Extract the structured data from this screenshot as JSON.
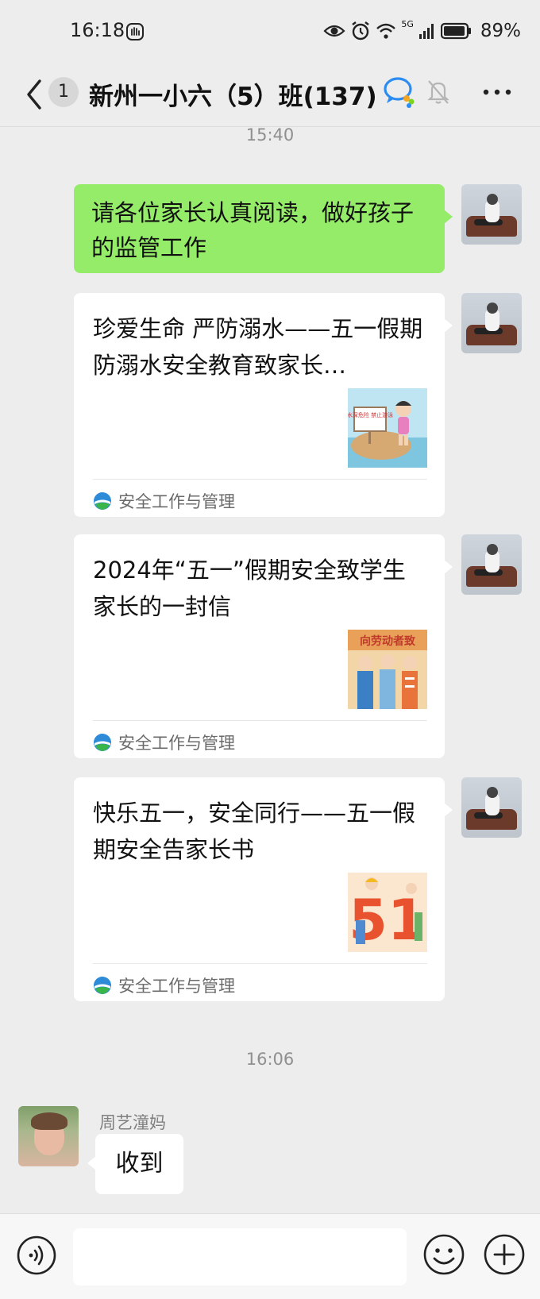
{
  "status_bar": {
    "time": "16:18",
    "network": "5G",
    "battery": "89%"
  },
  "header": {
    "unread_count": "1",
    "title": "新州一小六（5）班(137)"
  },
  "timestamps": [
    "15:40",
    "16:06"
  ],
  "messages": {
    "text_out": "请各位家长认真阅读，做好孩子的监管工作",
    "cards": [
      {
        "title": "珍爱生命 严防溺水——五一假期防溺水安全教育致家长…",
        "source": "安全工作与管理",
        "thumb_text": "水深危险 禁止游泳"
      },
      {
        "title": "2024年“五一”假期安全致学生家长的一封信",
        "source": "安全工作与管理",
        "thumb_text": "向劳动者致"
      },
      {
        "title": "快乐五一，安全同行——五一假期安全告家长书",
        "source": "安全工作与管理",
        "thumb_text": "51"
      }
    ],
    "incoming": {
      "sender": "周艺潼妈",
      "text": "收到"
    }
  },
  "colors": {
    "bubble_out": "#95ec69",
    "background": "#ededed",
    "card": "#ffffff"
  },
  "input": {
    "value": ""
  }
}
